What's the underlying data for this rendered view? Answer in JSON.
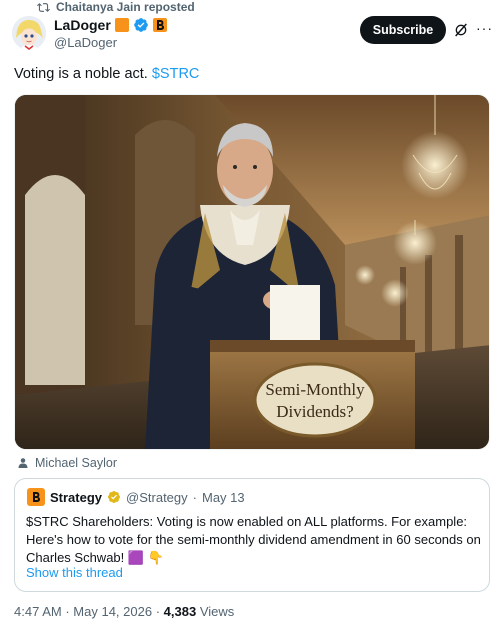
{
  "repost": {
    "text": "Chaitanya Jain reposted"
  },
  "author": {
    "name": "LaDoger",
    "handle": "@LaDoger"
  },
  "header": {
    "subscribe_label": "Subscribe",
    "more_label": "···"
  },
  "tweet": {
    "text": "Voting is a noble act.",
    "cashtag": "$STRC"
  },
  "media": {
    "sign_line1": "Semi-Monthly",
    "sign_line2": "Dividends?"
  },
  "tag": {
    "person": "Michael Saylor"
  },
  "quote": {
    "name": "Strategy",
    "handle": "@Strategy",
    "separator": "·",
    "date": "May 13",
    "text": "$STRC Shareholders: Voting is now enabled on ALL platforms. For example: Here's how to vote for the semi-monthly dividend amendment in 60 seconds on Charles Schwab! 🟪 👇",
    "show_thread": "Show this thread"
  },
  "footer": {
    "time": "4:47 AM",
    "date": "May 14, 2026",
    "views_count": "4,383",
    "views_label": "Views",
    "sep": "·"
  },
  "colors": {
    "accent": "#1d9bf0",
    "orange": "#f7931a",
    "text": "#0f1419",
    "muted": "#536471"
  }
}
